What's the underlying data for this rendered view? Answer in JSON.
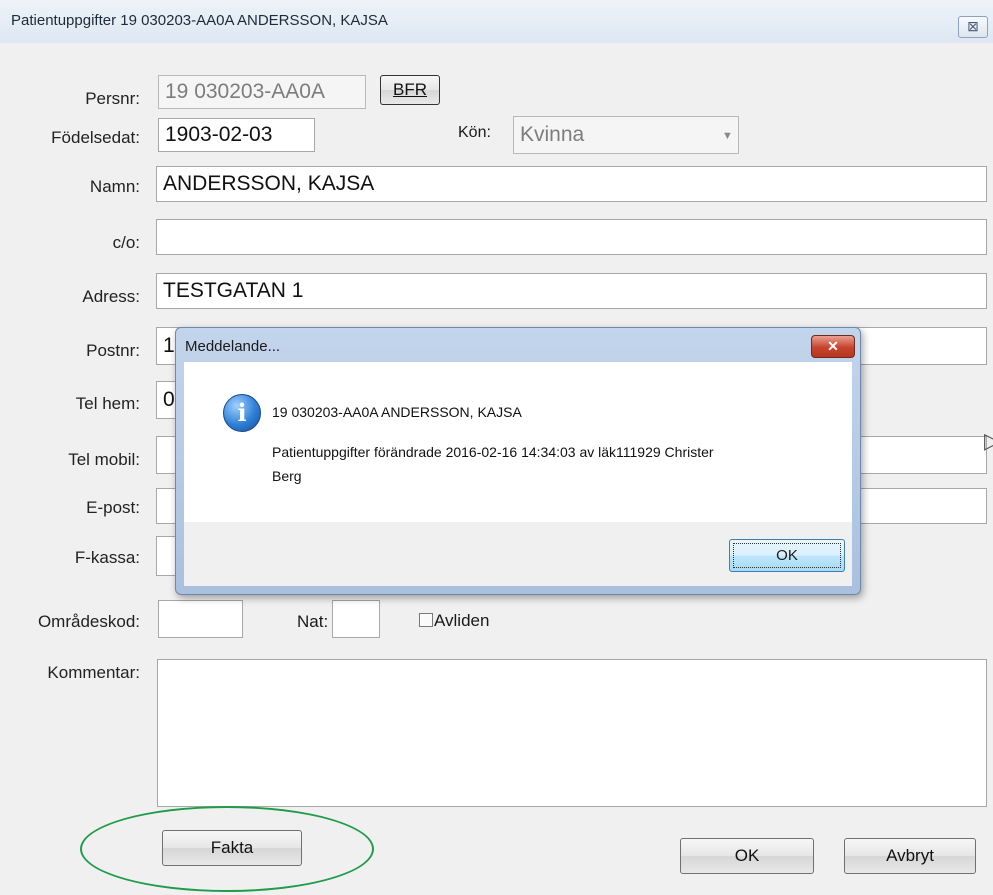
{
  "window": {
    "title": "Patientuppgifter 19 030203-AA0A ANDERSSON, KAJSA",
    "close_glyph": "⊠"
  },
  "form": {
    "persnr_label": "Persnr:",
    "persnr_value": "19 030203-AA0A",
    "bfr_button": "BFR",
    "fodelsedat_label": "Födelsedat:",
    "fodelsedat_value": "1903-02-03",
    "kon_label": "Kön:",
    "kon_value": "Kvinna",
    "namn_label": "Namn:",
    "namn_value": "ANDERSSON, KAJSA",
    "co_label": "c/o:",
    "co_value": "",
    "adress_label": "Adress:",
    "adress_value": "TESTGATAN 1",
    "postnr_label": "Postnr:",
    "postnr_value": "1",
    "telhem_label": "Tel hem:",
    "telhem_value": "0",
    "telmobil_label": "Tel mobil:",
    "epost_label": "E-post:",
    "fkassa_label": "F-kassa:",
    "omradeskod_label": "Områdeskod:",
    "nat_label": "Nat:",
    "avliden_label": "Avliden",
    "kommentar_label": "Kommentar:",
    "fakta_button": "Fakta",
    "ok_button": "OK",
    "avbryt_button": "Avbryt"
  },
  "dialog": {
    "title": "Meddelande...",
    "close_glyph": "✕",
    "line1": "19 030203-AA0A ANDERSSON, KAJSA",
    "line2": "Patientuppgifter förändrade 2016-02-16 14:34:03 av läk111929 Christer",
    "line3": "Berg",
    "ok_button": "OK",
    "icon": "info-icon"
  }
}
